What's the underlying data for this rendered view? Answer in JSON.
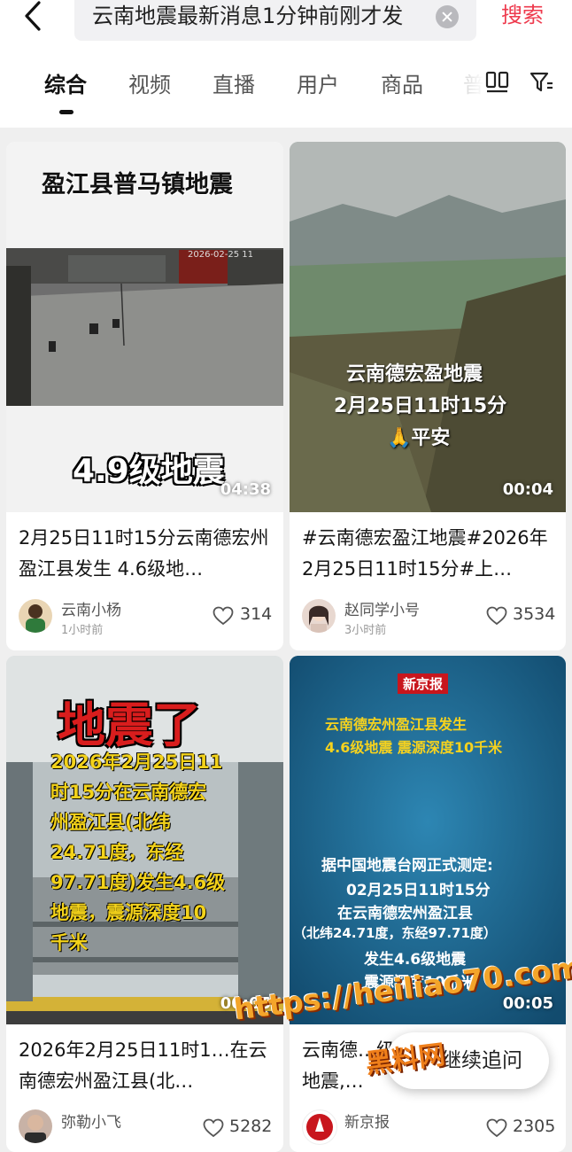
{
  "search": {
    "back_icon": "chevron-left-icon",
    "query": "云南地震最新消息1分钟前刚才发",
    "clear_icon": "clear-circle-icon",
    "submit_label": "搜索",
    "submit_color": "#ee3a4d"
  },
  "tabs": {
    "items": [
      "综合",
      "视频",
      "直播",
      "用户",
      "商品",
      "普"
    ],
    "active": "综合",
    "layout_icon": "dual-column-icon",
    "filter_icon": "filter-icon"
  },
  "feed": {
    "cards": [
      {
        "thumb_caption_top": "盈江县普马镇地震",
        "thumb_timestamp": "2026-02-25 11",
        "thumb_caption_bottom": "4.9级地震",
        "duration": "04:38",
        "title": "2月25日11时15分云南德宏州盈江县发生 4.6级地…",
        "author": "云南小杨",
        "time": "1小时前",
        "likes": "314"
      },
      {
        "thumb_line1": "云南德宏盈地震",
        "thumb_line2": "2月25日11时15分",
        "thumb_line3": "🙏平安",
        "duration": "00:04",
        "title": "#云南德宏盈江地震#2026年2月25日11时15分#上…",
        "author": "赵同学小号",
        "time": "3小时前",
        "likes": "3534"
      },
      {
        "thumb_headline": "地震了",
        "thumb_lines": [
          "2026年2月25日11",
          "时15分在云南德宏",
          "州盈江县(北纬",
          "24.71度，东经",
          "97.71度)发生4.6级",
          "地震，震源深度10",
          "千米"
        ],
        "duration": "00:05",
        "title": "2026年2月25日11时1…在云南德宏州盈江县(北…",
        "author": "弥勒小飞",
        "likes": "5282"
      },
      {
        "thumb_badge": "新京报",
        "thumb_head1": "云南德宏州盈江县发生",
        "thumb_head2": "4.6级地震 震源深度10千米",
        "thumb_body": [
          "据中国地震台网正式测定:",
          "02月25日11时15分",
          "在云南德宏州盈江县",
          "（北纬24.71度，东经97.71度）",
          "发生4.6级地震",
          "震源深度10千米"
        ],
        "duration": "00:05",
        "title": "云南德…级地震,…",
        "author": "新京报",
        "likes": "2305"
      }
    ]
  },
  "follow_up": {
    "label": "继续追问"
  },
  "watermark": {
    "url": "https://heiliao70.com",
    "brand": "黑料网"
  }
}
